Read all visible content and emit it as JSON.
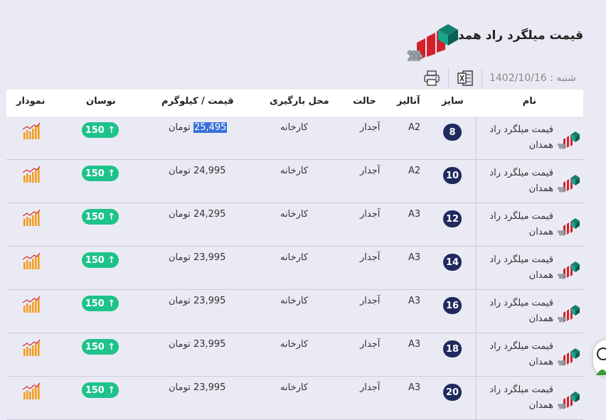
{
  "header": {
    "title": "قیمت میلگرد راد همدان"
  },
  "toolbar": {
    "date_label": "شنبه : 1402/10/16"
  },
  "table": {
    "columns": {
      "name": "نام",
      "size": "سایز",
      "analysis": "آنالیز",
      "state": "حالت",
      "location": "محل بارگیری",
      "price": "قیمت / کیلوگرم",
      "swing": "نوسان",
      "chart": "نمودار"
    },
    "rows": [
      {
        "name": "قیمت میلگرد راد همدان",
        "size": "8",
        "analysis": "A2",
        "state": "آجدار",
        "location": "کارخانه",
        "price": "25,495",
        "currency": "تومان",
        "swing": "150 ↑"
      },
      {
        "name": "قیمت میلگرد راد همدان",
        "size": "10",
        "analysis": "A2",
        "state": "آجدار",
        "location": "کارخانه",
        "price": "24,995",
        "currency": "تومان",
        "swing": "150 ↑"
      },
      {
        "name": "قیمت میلگرد راد همدان",
        "size": "12",
        "analysis": "A3",
        "state": "آجدار",
        "location": "کارخانه",
        "price": "24,295",
        "currency": "تومان",
        "swing": "150 ↑"
      },
      {
        "name": "قیمت میلگرد راد همدان",
        "size": "14",
        "analysis": "A3",
        "state": "آجدار",
        "location": "کارخانه",
        "price": "23,995",
        "currency": "تومان",
        "swing": "150 ↑"
      },
      {
        "name": "قیمت میلگرد راد همدان",
        "size": "16",
        "analysis": "A3",
        "state": "آجدار",
        "location": "کارخانه",
        "price": "23,995",
        "currency": "تومان",
        "swing": "150 ↑"
      },
      {
        "name": "قیمت میلگرد راد همدان",
        "size": "18",
        "analysis": "A3",
        "state": "آجدار",
        "location": "کارخانه",
        "price": "23,995",
        "currency": "تومان",
        "swing": "150 ↑"
      },
      {
        "name": "قیمت میلگرد راد همدان",
        "size": "20",
        "analysis": "A3",
        "state": "آجدار",
        "location": "کارخانه",
        "price": "23,995",
        "currency": "تومان",
        "swing": "150 ↑"
      }
    ]
  },
  "colors": {
    "background": "#eaeaf4",
    "size_badge": "#1f2a5e",
    "swing_badge": "#1ec28b",
    "chart_icon": "#f39c1f",
    "selection": "#3a6fd8"
  },
  "icons": {
    "logo": "rebar-logo-icon",
    "print": "printer-icon",
    "excel": "excel-icon",
    "row": "rebar-bundle-icon",
    "chart": "bar-chart-icon",
    "support": "support-chat-icon"
  }
}
